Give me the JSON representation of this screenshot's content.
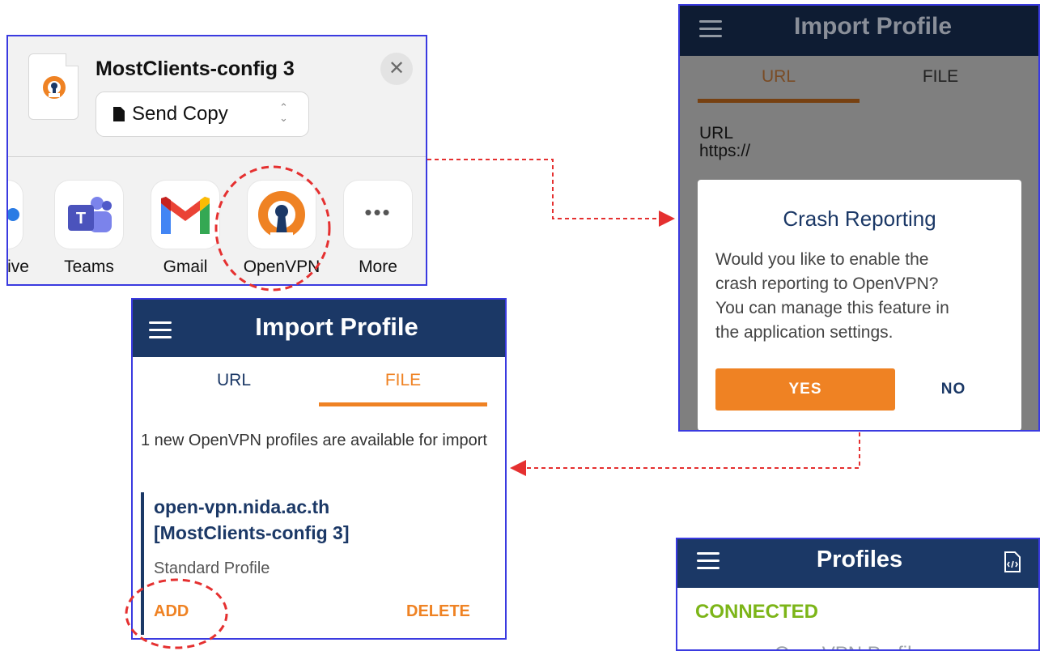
{
  "share_sheet": {
    "file_title": "MostClients-config 3",
    "send_mode": "Send Copy",
    "apps": [
      {
        "label": "ive"
      },
      {
        "label": "Teams"
      },
      {
        "label": "Gmail"
      },
      {
        "label": "OpenVPN"
      },
      {
        "label": "More"
      }
    ]
  },
  "import_file": {
    "title": "Import Profile",
    "tabs": [
      "URL",
      "FILE"
    ],
    "message": "1 new OpenVPN profiles are available for import",
    "profile_host": "open-vpn.nida.ac.th",
    "profile_name": "[MostClients-config 3]",
    "profile_type": "Standard Profile",
    "add_label": "ADD",
    "delete_label": "DELETE"
  },
  "import_url": {
    "title": "Import Profile",
    "tabs": [
      "URL",
      "FILE"
    ],
    "url_label": "URL",
    "url_value": "https://"
  },
  "crash_dialog": {
    "title": "Crash Reporting",
    "message_lines": [
      "Would you like to enable the",
      "crash reporting to OpenVPN?",
      "You can manage this feature in",
      "the application settings."
    ],
    "yes_label": "YES",
    "no_label": "NO"
  },
  "profiles": {
    "title": "Profiles",
    "status": "CONNECTED",
    "partial_item": "OpenVPN Profile"
  },
  "colors": {
    "navy": "#1b3866",
    "orange": "#ef8223",
    "connected_green": "#7cb518",
    "annotation_red": "#e53030",
    "panel_border": "#3a3ae0"
  }
}
